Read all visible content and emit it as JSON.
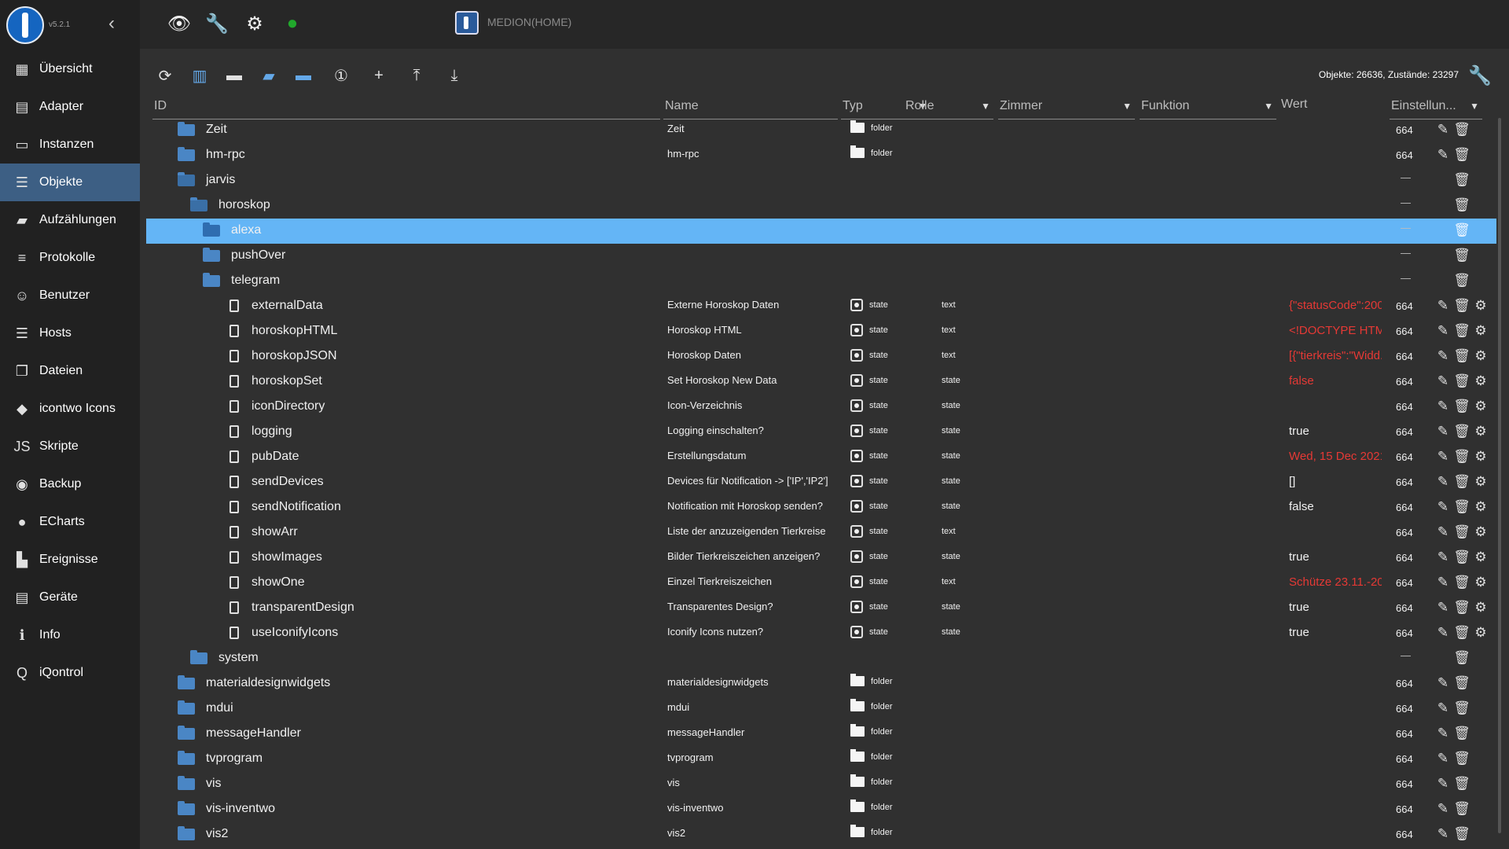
{
  "app": {
    "version": "v5.2.1",
    "host": "MEDION(HOME)"
  },
  "sidebar": {
    "items": [
      {
        "label": "Übersicht",
        "icon": "grid-icon",
        "glyph": "▦"
      },
      {
        "label": "Adapter",
        "icon": "store-icon",
        "glyph": "▤"
      },
      {
        "label": "Instanzen",
        "icon": "instances-icon",
        "glyph": "▭"
      },
      {
        "label": "Objekte",
        "icon": "list-icon",
        "glyph": "☰",
        "active": true
      },
      {
        "label": "Aufzählungen",
        "icon": "enums-icon",
        "glyph": "▰"
      },
      {
        "label": "Protokolle",
        "icon": "logs-icon",
        "glyph": "≡"
      },
      {
        "label": "Benutzer",
        "icon": "user-icon",
        "glyph": "☺"
      },
      {
        "label": "Hosts",
        "icon": "hosts-icon",
        "glyph": "☰"
      },
      {
        "label": "Dateien",
        "icon": "files-icon",
        "glyph": "❐"
      },
      {
        "label": "icontwo Icons",
        "icon": "icontwo-icon",
        "glyph": "◆"
      },
      {
        "label": "Skripte",
        "icon": "scripts-icon",
        "glyph": "JS"
      },
      {
        "label": "Backup",
        "icon": "backup-icon",
        "glyph": "◉"
      },
      {
        "label": "ECharts",
        "icon": "echarts-icon",
        "glyph": "●"
      },
      {
        "label": "Ereignisse",
        "icon": "events-icon",
        "glyph": "▙"
      },
      {
        "label": "Geräte",
        "icon": "devices-icon",
        "glyph": "▤"
      },
      {
        "label": "Info",
        "icon": "info-icon",
        "glyph": "ℹ"
      },
      {
        "label": "iQontrol",
        "icon": "iqontrol-icon",
        "glyph": "Q"
      }
    ]
  },
  "toolbar": {
    "stats": "Objekte: 26636, Zustände: 23297"
  },
  "columns": {
    "id": "ID",
    "name": "Name",
    "type": "Typ",
    "role": "Rolle",
    "room": "Zimmer",
    "function": "Funktion",
    "value": "Wert",
    "settings": "Einstellun..."
  },
  "rows": [
    {
      "id": "Zeit",
      "level": 1,
      "kind": "folder",
      "name": "Zeit",
      "type": "folder",
      "role": "",
      "value": "",
      "acl": "664",
      "edit": true,
      "gear": false
    },
    {
      "id": "hm-rpc",
      "level": 1,
      "kind": "folder",
      "name": "hm-rpc",
      "type": "folder",
      "role": "",
      "value": "",
      "acl": "664",
      "edit": true,
      "gear": false
    },
    {
      "id": "jarvis",
      "level": 1,
      "kind": "folder-open",
      "name": "",
      "type": "",
      "role": "",
      "value": "",
      "acl": "",
      "edit": false,
      "gear": false
    },
    {
      "id": "horoskop",
      "level": 2,
      "kind": "folder-open",
      "name": "",
      "type": "",
      "role": "",
      "value": "",
      "acl": "",
      "edit": false,
      "gear": false
    },
    {
      "id": "alexa",
      "level": 3,
      "kind": "folder",
      "name": "",
      "type": "",
      "role": "",
      "value": "",
      "acl": "",
      "edit": false,
      "gear": false,
      "selected": true
    },
    {
      "id": "pushOver",
      "level": 3,
      "kind": "folder",
      "name": "",
      "type": "",
      "role": "",
      "value": "",
      "acl": "",
      "edit": false,
      "gear": false
    },
    {
      "id": "telegram",
      "level": 3,
      "kind": "folder",
      "name": "",
      "type": "",
      "role": "",
      "value": "",
      "acl": "",
      "edit": false,
      "gear": false
    },
    {
      "id": "externalData",
      "level": 3,
      "kind": "file",
      "name": "Externe Horoskop Daten",
      "type": "state",
      "role": "text",
      "value": "{\"statusCode\":200...",
      "valueRed": true,
      "acl": "664",
      "edit": true,
      "gear": true
    },
    {
      "id": "horoskopHTML",
      "level": 3,
      "kind": "file",
      "name": "Horoskop HTML",
      "type": "state",
      "role": "text",
      "value": "<!DOCTYPE HTM...",
      "valueRed": true,
      "acl": "664",
      "edit": true,
      "gear": true
    },
    {
      "id": "horoskopJSON",
      "level": 3,
      "kind": "file",
      "name": "Horoskop Daten",
      "type": "state",
      "role": "text",
      "value": "[{\"tierkreis\":\"Widd...",
      "valueRed": true,
      "acl": "664",
      "edit": true,
      "gear": true
    },
    {
      "id": "horoskopSet",
      "level": 3,
      "kind": "file",
      "name": "Set Horoskop New Data",
      "type": "state",
      "role": "state",
      "value": "false",
      "valueRed": true,
      "acl": "664",
      "edit": true,
      "gear": true
    },
    {
      "id": "iconDirectory",
      "level": 3,
      "kind": "file",
      "name": "Icon-Verzeichnis",
      "type": "state",
      "role": "state",
      "value": "",
      "acl": "664",
      "edit": true,
      "gear": true
    },
    {
      "id": "logging",
      "level": 3,
      "kind": "file",
      "name": "Logging einschalten?",
      "type": "state",
      "role": "state",
      "value": "true",
      "acl": "664",
      "edit": true,
      "gear": true
    },
    {
      "id": "pubDate",
      "level": 3,
      "kind": "file",
      "name": "Erstellungsdatum",
      "type": "state",
      "role": "state",
      "value": "Wed, 15 Dec 2021...",
      "valueRed": true,
      "acl": "664",
      "edit": true,
      "gear": true
    },
    {
      "id": "sendDevices",
      "level": 3,
      "kind": "file",
      "name": "Devices für Notification -> ['IP','IP2']",
      "type": "state",
      "role": "state",
      "value": "[]",
      "acl": "664",
      "edit": true,
      "gear": true
    },
    {
      "id": "sendNotification",
      "level": 3,
      "kind": "file",
      "name": "Notification mit Horoskop senden?",
      "type": "state",
      "role": "state",
      "value": "false",
      "acl": "664",
      "edit": true,
      "gear": true
    },
    {
      "id": "showArr",
      "level": 3,
      "kind": "file",
      "name": "Liste der anzuzeigenden Tierkreise",
      "type": "state",
      "role": "text",
      "value": "",
      "acl": "664",
      "edit": true,
      "gear": true
    },
    {
      "id": "showImages",
      "level": 3,
      "kind": "file",
      "name": "Bilder Tierkreiszeichen anzeigen?",
      "type": "state",
      "role": "state",
      "value": "true",
      "acl": "664",
      "edit": true,
      "gear": true
    },
    {
      "id": "showOne",
      "level": 3,
      "kind": "file",
      "name": "Einzel Tierkreiszeichen",
      "type": "state",
      "role": "text",
      "value": "Schütze 23.11.-20....",
      "valueRed": true,
      "acl": "664",
      "edit": true,
      "gear": true
    },
    {
      "id": "transparentDesign",
      "level": 3,
      "kind": "file",
      "name": "Transparentes Design?",
      "type": "state",
      "role": "state",
      "value": "true",
      "acl": "664",
      "edit": true,
      "gear": true
    },
    {
      "id": "useIconifyIcons",
      "level": 3,
      "kind": "file",
      "name": "Iconify Icons nutzen?",
      "type": "state",
      "role": "state",
      "value": "true",
      "acl": "664",
      "edit": true,
      "gear": true
    },
    {
      "id": "system",
      "level": 2,
      "kind": "folder",
      "name": "",
      "type": "",
      "role": "",
      "value": "",
      "acl": "",
      "edit": false,
      "gear": false
    },
    {
      "id": "materialdesignwidgets",
      "level": 1,
      "kind": "folder",
      "name": "materialdesignwidgets",
      "type": "folder",
      "role": "",
      "value": "",
      "acl": "664",
      "edit": true,
      "gear": false
    },
    {
      "id": "mdui",
      "level": 1,
      "kind": "folder",
      "name": "mdui",
      "type": "folder",
      "role": "",
      "value": "",
      "acl": "664",
      "edit": true,
      "gear": false
    },
    {
      "id": "messageHandler",
      "level": 1,
      "kind": "folder",
      "name": "messageHandler",
      "type": "folder",
      "role": "",
      "value": "",
      "acl": "664",
      "edit": true,
      "gear": false
    },
    {
      "id": "tvprogram",
      "level": 1,
      "kind": "folder",
      "name": "tvprogram",
      "type": "folder",
      "role": "",
      "value": "",
      "acl": "664",
      "edit": true,
      "gear": false
    },
    {
      "id": "vis",
      "level": 1,
      "kind": "folder",
      "name": "vis",
      "type": "folder",
      "role": "",
      "value": "",
      "acl": "664",
      "edit": true,
      "gear": false
    },
    {
      "id": "vis-inventwo",
      "level": 1,
      "kind": "folder",
      "name": "vis-inventwo",
      "type": "folder",
      "role": "",
      "value": "",
      "acl": "664",
      "edit": true,
      "gear": false
    },
    {
      "id": "vis2",
      "level": 1,
      "kind": "folder",
      "name": "vis2",
      "type": "folder",
      "role": "",
      "value": "",
      "acl": "664",
      "edit": true,
      "gear": false
    }
  ]
}
